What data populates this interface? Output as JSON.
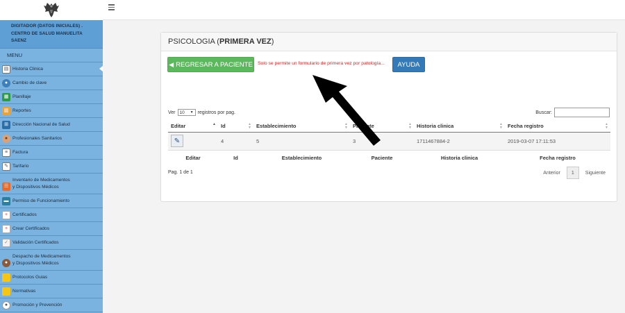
{
  "user": {
    "line1": "DIGITADOR (DATOS INICIALES) .",
    "line2": "CENTRO DE SALUD MANUELITA",
    "line3": "SAENZ"
  },
  "menu": {
    "title": "MENU",
    "items": [
      {
        "label": "Historia Clinica",
        "icon": "clipboard-icon"
      },
      {
        "label": "Cambio de clave",
        "icon": "key-icon"
      },
      {
        "label": "Planillaje",
        "icon": "spreadsheet-icon"
      },
      {
        "label": "Reportes",
        "icon": "report-icon"
      },
      {
        "label": "Dirección Nacional de Salud",
        "icon": "network-icon"
      },
      {
        "label": "Profesionales Sanitarios",
        "icon": "user-icon"
      },
      {
        "label": "Factura",
        "icon": "invoice-icon"
      },
      {
        "label": "Tarifario",
        "icon": "price-list-icon"
      },
      {
        "label": "Inventario de Medicamentos y Dispositivos Médicos",
        "line1": "Inventario de Medicamentos",
        "line2": "y Dispositivos Médicos",
        "icon": "inventory-icon"
      },
      {
        "label": "Permiso de Funcionamiento",
        "icon": "permit-icon"
      },
      {
        "label": "Certificados",
        "icon": "certificate-icon"
      },
      {
        "label": "Crear Certificados",
        "icon": "create-certificate-icon"
      },
      {
        "label": "Validación Certificados",
        "icon": "validate-certificate-icon"
      },
      {
        "label": "Despacho de Medicamentos y Dispositivos Médicos",
        "line1": "Despacho de Medicamentos",
        "line2": "y Dispositivos Médicos",
        "icon": "delivery-icon"
      },
      {
        "label": "Protocolos Guias",
        "icon": "folder-icon"
      },
      {
        "label": "Normativas",
        "icon": "folder-icon"
      },
      {
        "label": "Promoción y Prevención",
        "icon": "doctor-icon"
      }
    ]
  },
  "panel": {
    "title_prefix": "PSICOLOGIA (",
    "title_bold": "PRIMERA VEZ",
    "title_suffix": ")"
  },
  "actions": {
    "back_label": "REGRESAR A PACIENTE",
    "warning": "Solo se permite un formulario de primera vez por patología...",
    "help_label": "AYUDA"
  },
  "table_controls": {
    "show_prefix": "Ver",
    "page_size": "10",
    "show_suffix": "registros por pag.",
    "search_label": "Buscar:",
    "search_value": ""
  },
  "table": {
    "columns": [
      "Editar",
      "Id",
      "Establecimiento",
      "Paciente",
      "Historia clinica",
      "Fecha registro"
    ],
    "rows": [
      {
        "id": "4",
        "establecimiento": "5",
        "paciente": "3",
        "historia": "1711467884-2",
        "fecha": "2019-03-07 17:11:53"
      }
    ]
  },
  "pagination": {
    "info": "Pag. 1 de 1",
    "prev": "Anterior",
    "page": "1",
    "next": "Siguiente"
  },
  "colors": {
    "sidebar": "#7ab3e0",
    "primary_green": "#5cb85c",
    "primary_blue": "#337ab7",
    "warning_red": "#e02020"
  }
}
